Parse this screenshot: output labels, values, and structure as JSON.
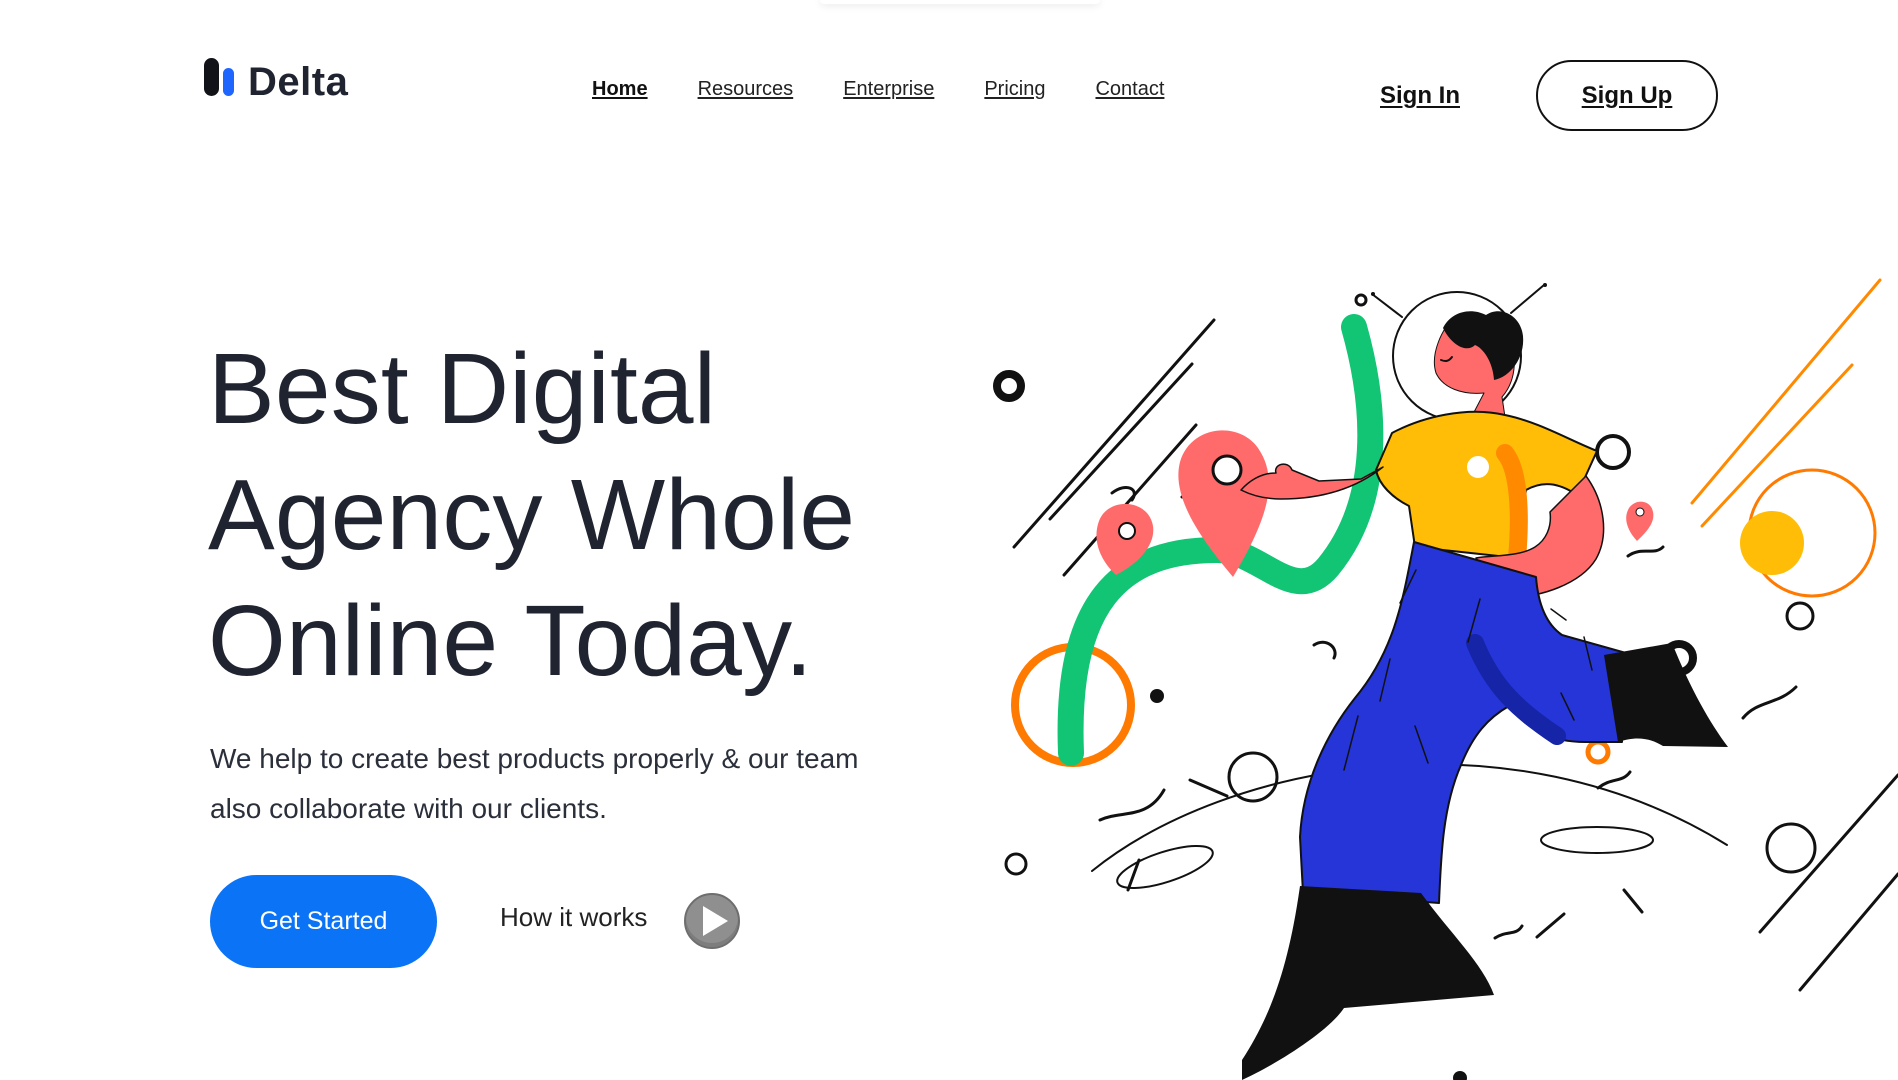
{
  "brand": {
    "name": "Delta",
    "colors": {
      "dark": "#111318",
      "accent": "#1f66ff"
    }
  },
  "nav": {
    "items": [
      {
        "label": "Home",
        "active": true
      },
      {
        "label": "Resources",
        "active": false
      },
      {
        "label": "Enterprise",
        "active": false
      },
      {
        "label": "Pricing",
        "active": false
      },
      {
        "label": "Contact",
        "active": false
      }
    ]
  },
  "auth": {
    "sign_in": "Sign In",
    "sign_up": "Sign Up"
  },
  "hero": {
    "title_lines": [
      "Best Digital",
      "Agency Whole",
      "Online Today."
    ],
    "description": "We help to create best products properly & our team also collaborate with our clients.",
    "cta_label": "Get Started",
    "secondary_label": "How it works",
    "play_icon": "play-icon",
    "colors": {
      "primary_button": "#0b73f5",
      "text": "#1f2430"
    }
  },
  "illustration": {
    "subject": "astronaut-character",
    "colors": {
      "green": "#11c574",
      "orange": "#ff7a00",
      "yellow": "#ffbd07",
      "coral": "#ff6b6b",
      "blue": "#2535d8",
      "black": "#111111"
    }
  }
}
